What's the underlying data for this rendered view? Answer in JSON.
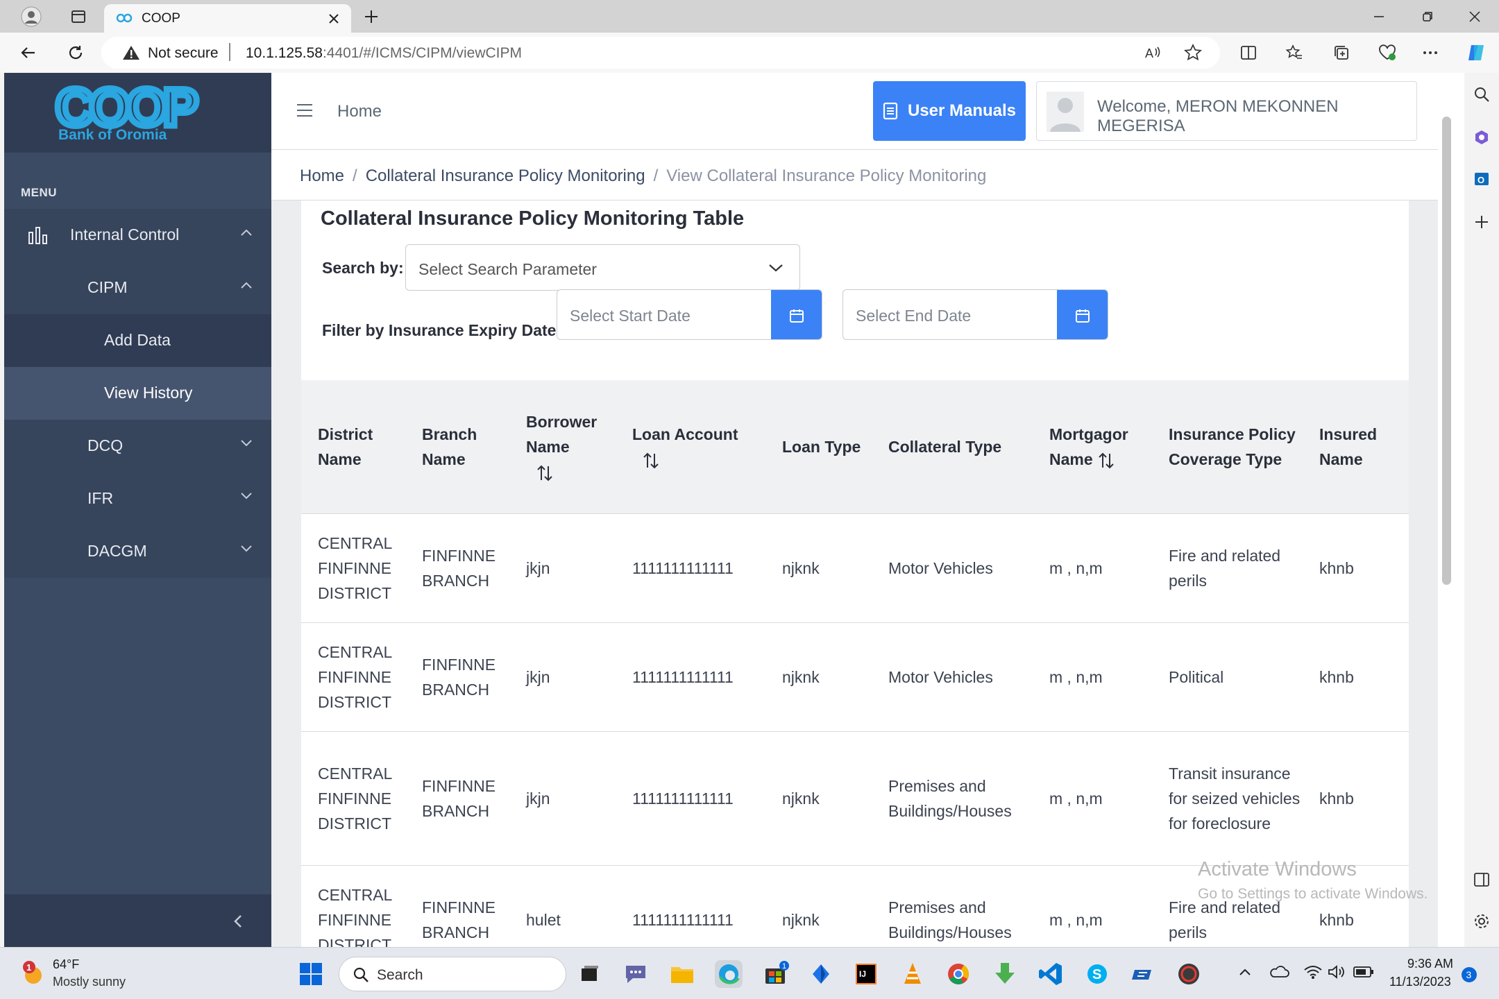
{
  "browser": {
    "tab_title": "COOP",
    "security_label": "Not secure",
    "url_host": "10.1.125.58",
    "url_path": ":4401/#/ICMS/CIPM/viewCIPM"
  },
  "logo": {
    "brand": "COOP",
    "tagline": "Bank of Oromia"
  },
  "sidebar": {
    "menu_title": "MENU",
    "items": [
      {
        "label": "Internal Control"
      },
      {
        "label": "CIPM"
      },
      {
        "label": "Add Data"
      },
      {
        "label": "View History"
      },
      {
        "label": "DCQ"
      },
      {
        "label": "IFR"
      },
      {
        "label": "DACGM"
      }
    ]
  },
  "header": {
    "home_label": "Home",
    "manuals_label": "User Manuals",
    "welcome": "Welcome, MERON MEKONNEN MEGERISA"
  },
  "breadcrumb": [
    "Home",
    "Collateral Insurance Policy Monitoring",
    "View Collateral Insurance Policy Monitoring"
  ],
  "card": {
    "title": "Collateral Insurance Policy Monitoring Table",
    "search_label": "Search by:",
    "search_placeholder": "Select Search Parameter",
    "filter_label": "Filter by Insurance Expiry Date:",
    "start_placeholder": "Select Start Date",
    "end_placeholder": "Select End Date"
  },
  "table": {
    "headers": [
      "District Name",
      "Branch Name",
      "Borrower Name",
      "Loan Account",
      "Loan Type",
      "Collateral Type",
      "Mortgagor Name",
      "Insurance Policy Coverage Type",
      "Insured Name"
    ],
    "rows": [
      [
        "CENTRAL FINFINNE DISTRICT",
        "FINFINNE BRANCH",
        "jkjn",
        "1111111111111",
        "njknk",
        "Motor Vehicles",
        "m , n,m",
        "Fire and related perils",
        "khnb"
      ],
      [
        "CENTRAL FINFINNE DISTRICT",
        "FINFINNE BRANCH",
        "jkjn",
        "1111111111111",
        "njknk",
        "Motor Vehicles",
        "m , n,m",
        "Political",
        "khnb"
      ],
      [
        "CENTRAL FINFINNE DISTRICT",
        "FINFINNE BRANCH",
        "jkjn",
        "1111111111111",
        "njknk",
        "Premises and Buildings/Houses",
        "m , n,m",
        "Transit insurance for seized vehicles for foreclosure",
        "khnb"
      ],
      [
        "CENTRAL FINFINNE DISTRICT",
        "FINFINNE BRANCH",
        "hulet",
        "1111111111111",
        "njknk",
        "Premises and Buildings/Houses",
        "m , n,m",
        "Fire and related perils",
        "khnb"
      ]
    ]
  },
  "watermark": {
    "line1": "Activate Windows",
    "line2": "Go to Settings to activate Windows."
  },
  "taskbar": {
    "weather_temp": "64°F",
    "weather_desc": "Mostly sunny",
    "weather_badge": "1",
    "search_label": "Search",
    "time": "9:36 AM",
    "date": "11/13/2023",
    "notif_count": "3",
    "store_badge": "1"
  },
  "colors": {
    "sidebar": "#3c4b64",
    "accent": "#3b82f6",
    "logo": "#2aa6e0"
  }
}
